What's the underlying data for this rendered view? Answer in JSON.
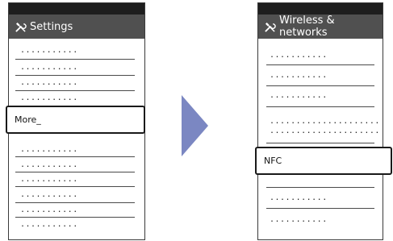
{
  "left_screen": {
    "title": "Settings",
    "item_placeholder": "...........",
    "highlighted_item": "More",
    "cursor": "_"
  },
  "right_screen": {
    "title": "Wireless & networks",
    "item_placeholder": "...........",
    "long_item_placeholder": ".....................",
    "highlighted_item": "NFC"
  },
  "colors": {
    "title_bar": "#505050",
    "status_bar": "#1e1e1e",
    "arrow": "#7b87c2"
  },
  "icons": {
    "settings": "wrench-screwdriver-icon",
    "transition": "arrow-right-icon"
  }
}
